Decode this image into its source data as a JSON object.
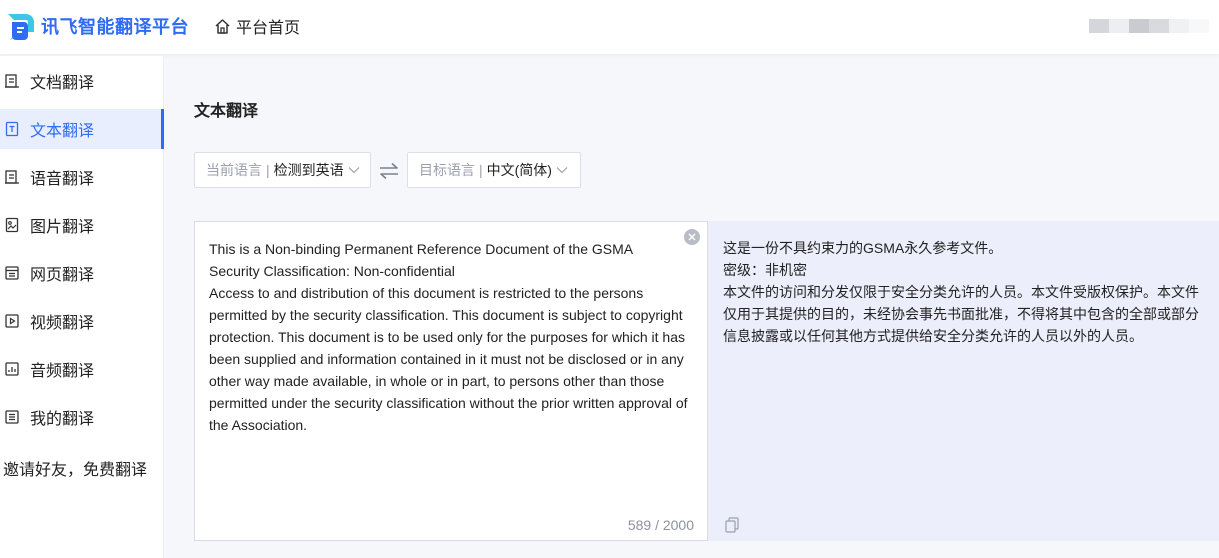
{
  "header": {
    "brand": "讯飞智能翻译平台",
    "home_label": "平台首页",
    "colors": {
      "brand": "#2f6cf3"
    }
  },
  "sidebar": {
    "items": [
      {
        "label": "文档翻译",
        "icon": "document-icon"
      },
      {
        "label": "文本翻译",
        "icon": "text-icon",
        "active": true
      },
      {
        "label": "语音翻译",
        "icon": "voice-icon"
      },
      {
        "label": "图片翻译",
        "icon": "image-icon"
      },
      {
        "label": "网页翻译",
        "icon": "webpage-icon"
      },
      {
        "label": "视频翻译",
        "icon": "video-icon"
      },
      {
        "label": "音频翻译",
        "icon": "audio-icon"
      },
      {
        "label": "我的翻译",
        "icon": "list-icon"
      }
    ],
    "invite_label": "邀请好友，免费翻译"
  },
  "main": {
    "title": "文本翻译",
    "source_lang": {
      "label": "当前语言",
      "value": "检测到英语"
    },
    "target_lang": {
      "label": "目标语言",
      "value": "中文(简体)"
    },
    "source_text": "This is a Non-binding Permanent Reference Document of the GSMA\nSecurity Classification: Non-confidential\nAccess to and distribution of this document is restricted to the persons permitted by the security classification. This document is subject to copyright protection. This document is to be used only for the purposes for which it has been supplied and information contained in it must not be disclosed or in any other way made available, in whole or in part, to persons other than those permitted under the security classification without the prior written approval of the Association.",
    "char_count": "589 / 2000",
    "target_text": "这是一份不具约束力的GSMA永久参考文件。\n密级：非机密\n本文件的访问和分发仅限于安全分类允许的人员。本文件受版权保护。本文件仅用于其提供的目的，未经协会事先书面批准，不得将其中包含的全部或部分信息披露或以任何其他方式提供给安全分类允许的人员以外的人员。"
  }
}
